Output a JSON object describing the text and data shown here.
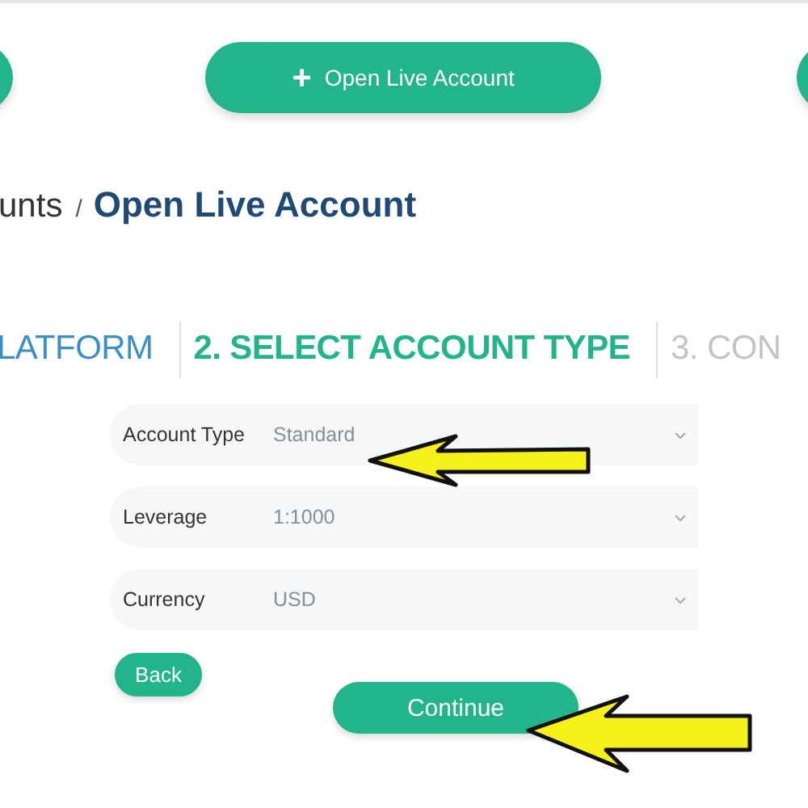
{
  "top_buttons": [
    {
      "label": "+",
      "text": "Open Live Account"
    }
  ],
  "breadcrumb": {
    "parent": "unts",
    "separator": "/",
    "current": "Open Live Account"
  },
  "steps": [
    {
      "label": "LATFORM",
      "selected": false,
      "completed": true
    },
    {
      "label": "2. SELECT ACCOUNT TYPE",
      "selected": true,
      "completed": false
    },
    {
      "label": "3. CON",
      "selected": false,
      "completed": false
    }
  ],
  "fields": [
    {
      "label": "Account Type",
      "value": "Standard"
    },
    {
      "label": "Leverage",
      "value": "1:1000"
    },
    {
      "label": "Currency",
      "value": "USD"
    }
  ],
  "back_button": "Back",
  "continue_button": "Continue"
}
